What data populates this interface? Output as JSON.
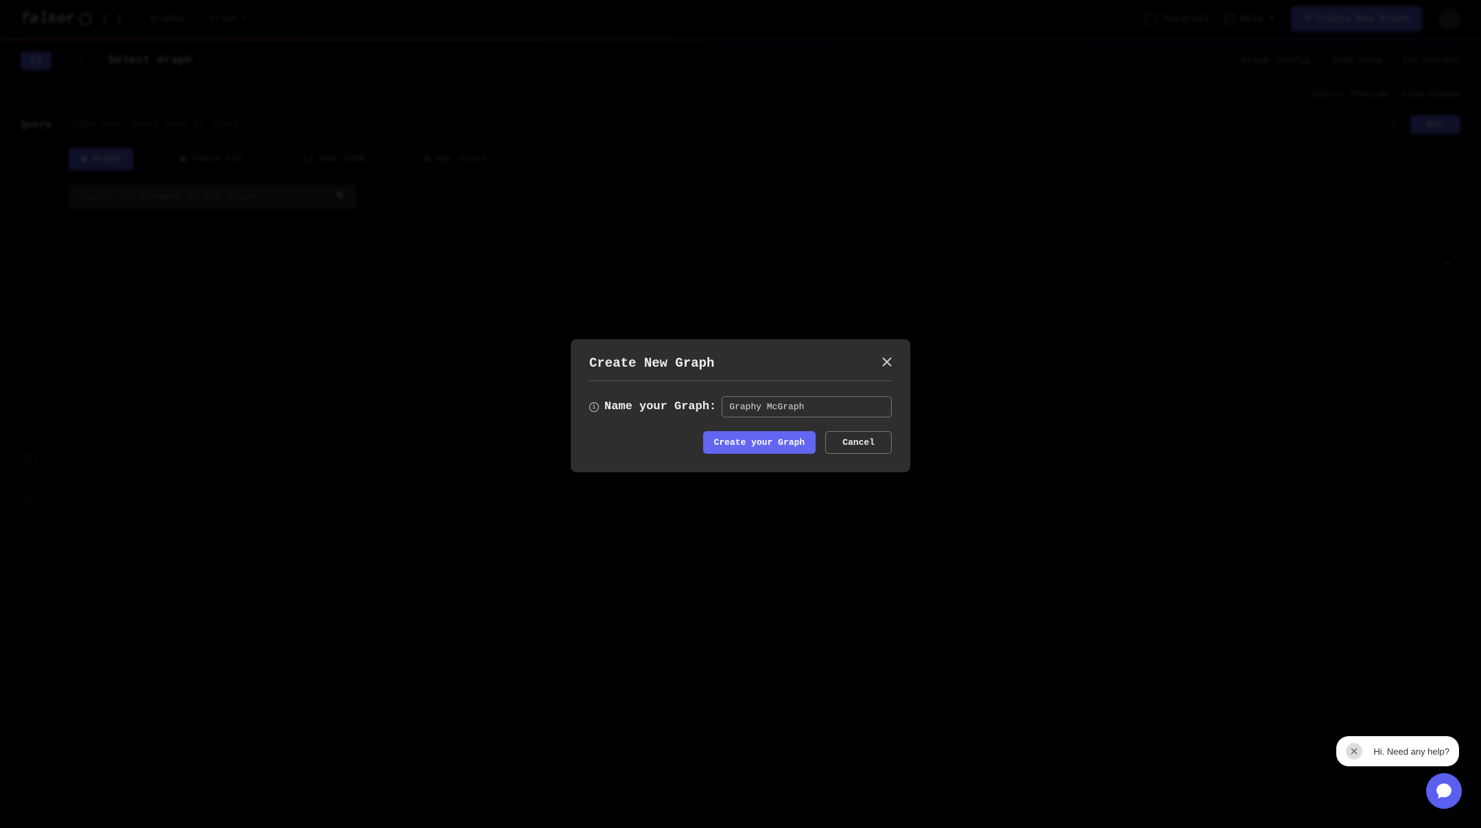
{
  "nav": {
    "logo": "falkor",
    "logo_suffix": "[ ]",
    "graphs_label": "Graphs",
    "graph_select": "Graph",
    "tutorial": "Tutorial",
    "help": "Help",
    "create_btn": "Create New Graph"
  },
  "secondary": {
    "chip": "[]",
    "breadcrumb_sep1": "(",
    "breadcrumb_icon": "o",
    "breadcrumb_sep2": ")",
    "breadcrumb_text": "Select Graph",
    "graph_config": "Graph Config",
    "json_view": "JSON View",
    "fullscreen": "Fullscreen"
  },
  "subtabs": {
    "editor_preview": "Editor Preview",
    "view_schema": "View Schema"
  },
  "query": {
    "label": "Query",
    "hint": "Type your query here to start",
    "run": "Run"
  },
  "tabs": {
    "graph": "Graph",
    "table": "Table (0)",
    "raw_json": "Raw JSON",
    "sql": "SQL Store"
  },
  "search": {
    "placeholder": "Search for Element in the graph"
  },
  "modal": {
    "title": "Create New Graph",
    "label": "Name your Graph:",
    "input_value": "Graphy McGraph",
    "create_btn": "Create your Graph",
    "cancel_btn": "Cancel"
  },
  "chat": {
    "tooltip": "Hi. Need any help?"
  }
}
